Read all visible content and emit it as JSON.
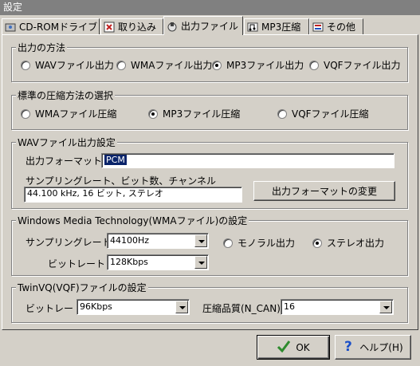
{
  "window": {
    "title": "設定"
  },
  "tabs": [
    {
      "label": "CD-ROMドライブ",
      "icon": "cd-drive-icon"
    },
    {
      "label": "取り込み",
      "icon": "import-icon"
    },
    {
      "label": "出力ファイル",
      "icon": "output-file-icon",
      "active": true
    },
    {
      "label": "MP3圧縮",
      "icon": "mp3-icon"
    },
    {
      "label": "その他",
      "icon": "other-icon"
    }
  ],
  "output_method": {
    "title": "出力の方法",
    "options": [
      "WAVファイル出力",
      "WMAファイル出力",
      "MP3ファイル出力",
      "VQFファイル出力"
    ],
    "selected": "MP3ファイル出力"
  },
  "compression": {
    "title": "標準の圧縮方法の選択",
    "options": [
      "WMAファイル圧縮",
      "MP3ファイル圧縮",
      "VQFファイル圧縮"
    ],
    "selected": "MP3ファイル圧縮"
  },
  "wav": {
    "title": "WAVファイル出力設定",
    "format_label": "出力フォーマット",
    "format_value": "PCM",
    "sampling_label": "サンプリングレート、ビット数、チャンネル",
    "sampling_value": "44.100 kHz, 16 ビット, ステレオ",
    "change_button": "出力フォーマットの変更"
  },
  "wma": {
    "title": "Windows Media Technology(WMAファイル)の設定",
    "sampling_label": "サンプリングレート",
    "sampling_value": "44100Hz",
    "bitrate_label": "ビットレート",
    "bitrate_value": "128Kbps",
    "mono_label": "モノラル出力",
    "stereo_label": "ステレオ出力",
    "selected": "ステレオ出力"
  },
  "vqf": {
    "title": "TwinVQ(VQF)ファイルの設定",
    "bitrate_label": "ビットレート",
    "bitrate_value": "96Kbps",
    "quality_label": "圧縮品質(N_CAN)",
    "quality_value": "16"
  },
  "buttons": {
    "ok": "OK",
    "help": "ヘルプ(H)"
  },
  "colors": {
    "face": "#d4d0c8",
    "title_bg": "#808080",
    "highlight": "#0a246a",
    "ok_check": "#2e8b2e",
    "help_q": "#1c50c8"
  }
}
